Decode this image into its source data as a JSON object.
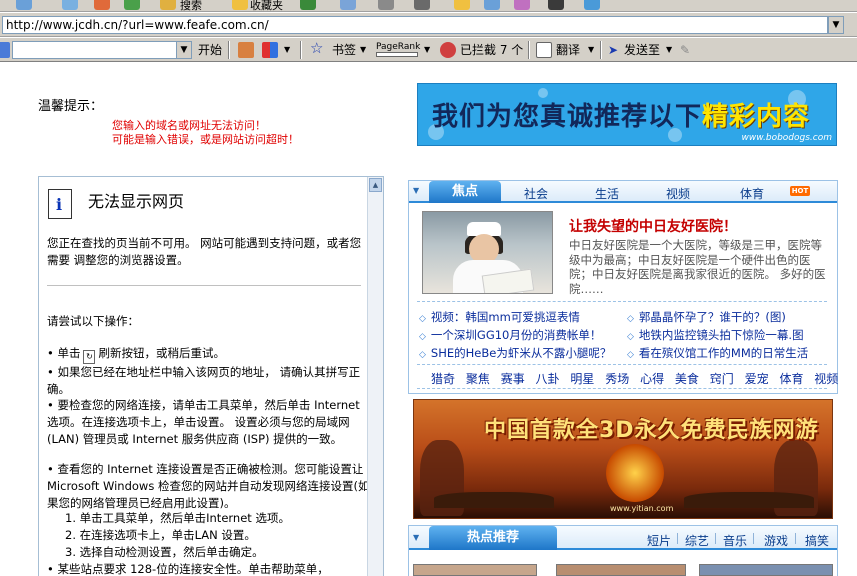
{
  "browser": {
    "top_labels": [
      "搜索",
      "收藏夹"
    ],
    "address_url": "http://www.jcdh.cn/?url=www.feafe.com.cn/",
    "google_bar": {
      "search_button": "开始",
      "bookmarks": "书签",
      "pagerank": "PageRank",
      "blocked": "已拦截 7 个",
      "translate": "翻译",
      "send_to": "发送至"
    }
  },
  "notice": {
    "title": "温馨提示：",
    "line1": "您输入的域名或网址无法访问！",
    "line2": "可能是输入错误，或是网站访问超时！"
  },
  "top_banner": {
    "text_main": "我们为您真诚推荐以下",
    "text_highlight": "精彩内容",
    "url": "www.bobodogs.com"
  },
  "error_page": {
    "title": "无法显示网页",
    "intro": "您正在查找的页当前不可用。 网站可能遇到支持问题，或者您需要 调整您的浏览器设置。",
    "try_header": "请尝试以下操作：",
    "bullet1": "• 单击",
    "bullet1_after": "刷新按钮，或稍后重试。",
    "bullet2": "• 如果您已经在地址栏中输入该网页的地址， 请确认其拼写正确。",
    "bullet3": "• 要检查您的网络连接，请单击工具菜单，然后单击 Internet 选项。在连接选项卡上，单击设置。 设置必须与您的局域网 (LAN) 管理员或 Internet 服务供应商 (ISP) 提供的一致。",
    "bullet4": "• 查看您的 Internet 连接设置是否正确被检测。您可能设置让 Microsoft Windows 检查您的网站并自动发现网络连接设置(如果您的网络管理员已经启用此设置)。",
    "step1": "1.  单击工具菜单，然后单击Internet 选项。",
    "step2": "2.  在连接选项卡上，单击LAN 设置。",
    "step3": "3.  选择自动检测设置，然后单击确定。",
    "bullet5": "• 某些站点要求 128-位的连接安全性。单击帮助菜单，"
  },
  "news": {
    "tabs": [
      "焦点",
      "社会",
      "生活",
      "视频",
      "体育"
    ],
    "hot_badge": "HOT",
    "headline": "让我失望的中日友好医院！",
    "summary": "中日友好医院是一个大医院，等级是三甲，医院等级中为最高；中日友好医院是一个硬件出色的医院；中日友好医院是离我家很近的医院。 多好的医院……",
    "links_left": [
      "视频：韩国mm可爱挑逗表情",
      "一个深圳GG10月份的消费帐单！",
      "SHE的HeBe为虾米从不露小腿呢？"
    ],
    "links_right": [
      "郭晶晶怀孕了？谁干的？(图)",
      "地铁内监控镜头拍下惊险一幕.图",
      "看在殡仪馆工作的MM的日常生活"
    ],
    "categories": [
      "猎奇",
      "聚焦",
      "赛事",
      "八卦",
      "明星",
      "秀场",
      "心得",
      "美食",
      "窍门",
      "爱宠",
      "体育",
      "视频"
    ]
  },
  "game_banner": {
    "title": "中国首款全3D永久免费民族网游",
    "url": "www.yitian.com"
  },
  "hot_panel": {
    "active_tab": "热点推荐",
    "tabs": [
      "短片",
      "综艺",
      "音乐",
      "游戏",
      "搞笑"
    ]
  }
}
